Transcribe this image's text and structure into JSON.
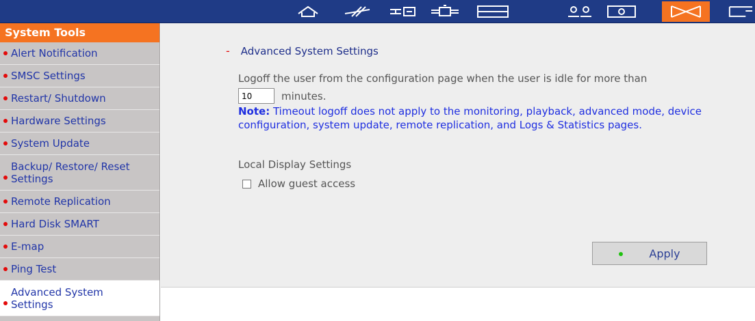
{
  "toolbar": {
    "icons": [
      "home-icon",
      "quick-config-icon",
      "server-icon",
      "network-icon",
      "disk-icon",
      "users-icon",
      "display-icon",
      "mail-icon",
      "more-icon"
    ],
    "active_icon": "mail-icon",
    "bg_color": "#1f3b86",
    "accent_color": "#f57321"
  },
  "sidebar": {
    "header": "System Tools",
    "items": [
      {
        "label": "Alert Notification"
      },
      {
        "label": "SMSC Settings"
      },
      {
        "label": "Restart/ Shutdown"
      },
      {
        "label": "Hardware Settings"
      },
      {
        "label": "System Update"
      },
      {
        "label": "Backup/ Restore/ Reset Settings"
      },
      {
        "label": "Remote Replication"
      },
      {
        "label": "Hard Disk SMART"
      },
      {
        "label": "E-map"
      },
      {
        "label": "Ping Test"
      },
      {
        "label": "Advanced System Settings",
        "active": true
      }
    ]
  },
  "main": {
    "dash": "-",
    "title": "Advanced System Settings",
    "description": "Logoff the user from the configuration page when the user is idle for more than",
    "minutes_value": "10",
    "minutes_label": "minutes.",
    "note_label": "Note:",
    "note_text": " Timeout logoff does not apply to the monitoring, playback, advanced mode, device configuration, system update, remote replication, and Logs & Statistics pages.",
    "local_display_title": "Local Display Settings",
    "guest_access_label": "Allow guest access",
    "guest_access_checked": false,
    "apply_label": "Apply"
  }
}
